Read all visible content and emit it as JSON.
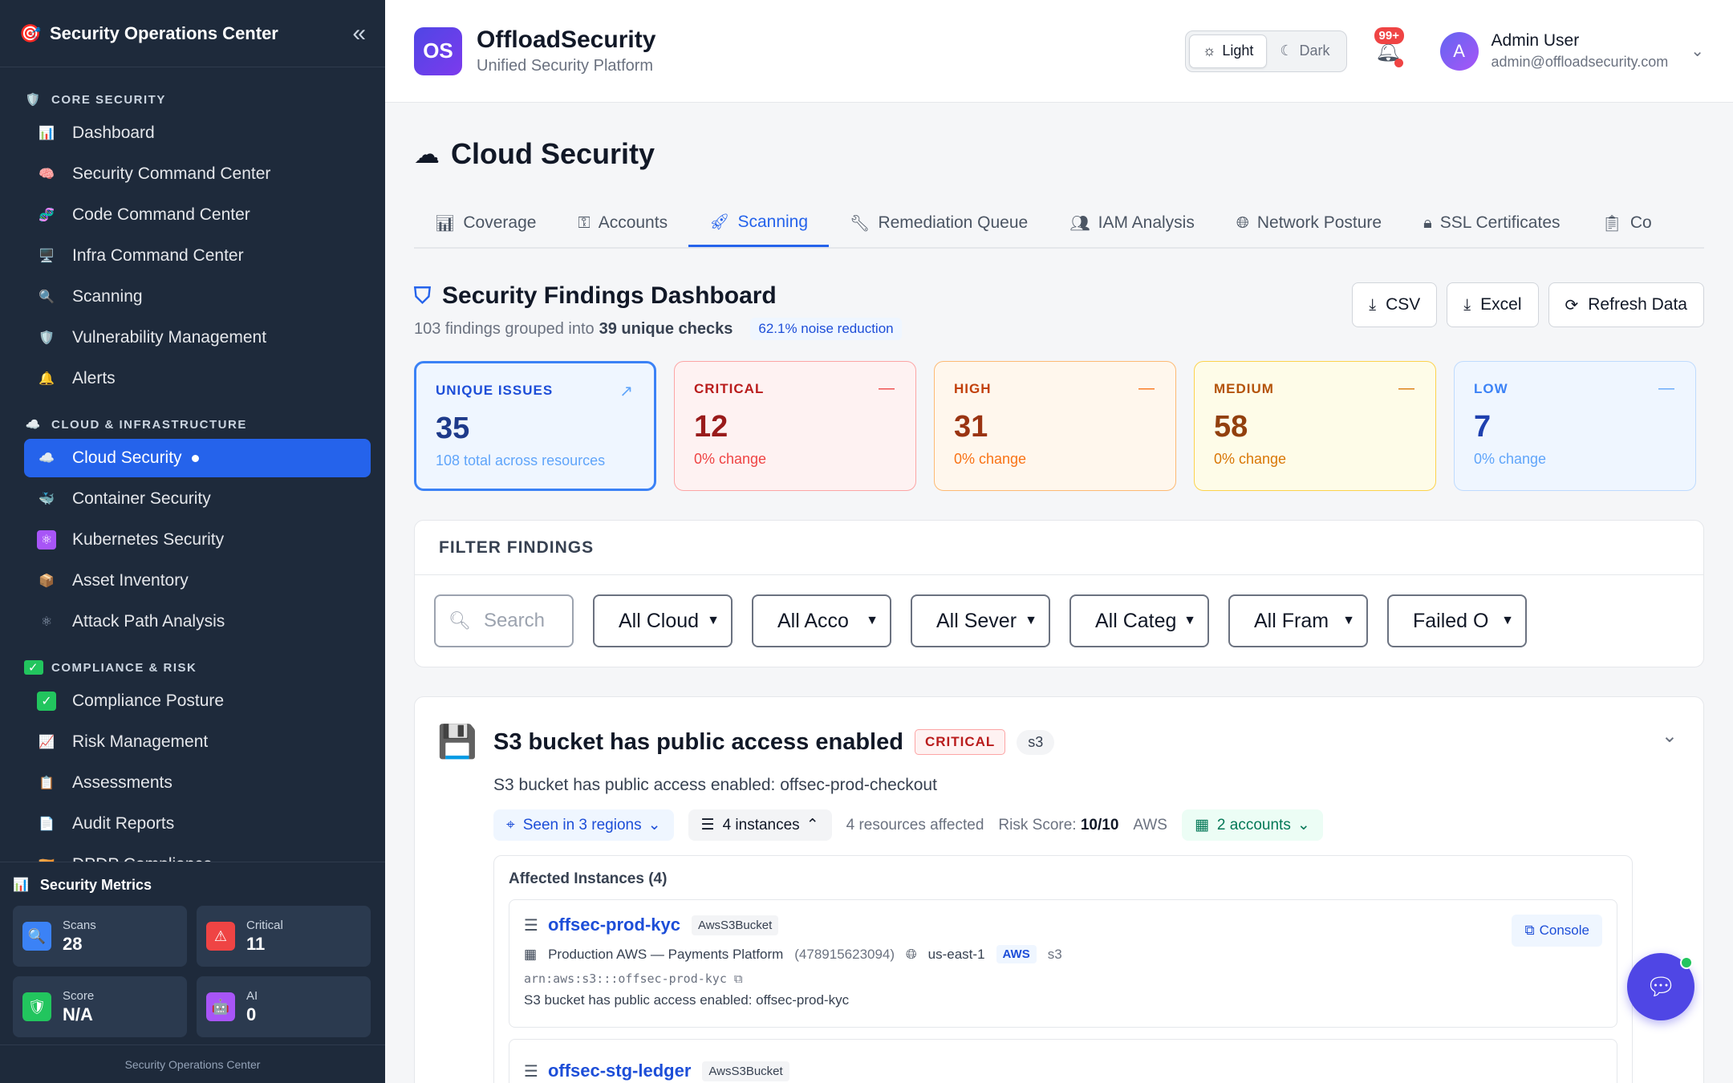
{
  "sidebar": {
    "title": "Security Operations Center",
    "sections": [
      {
        "label": "CORE SECURITY",
        "items": [
          {
            "label": "Dashboard",
            "icon": "bar-chart-icon"
          },
          {
            "label": "Security Command Center",
            "icon": "brain-icon"
          },
          {
            "label": "Code Command Center",
            "icon": "dna-icon"
          },
          {
            "label": "Infra Command Center",
            "icon": "monitor-icon"
          },
          {
            "label": "Scanning",
            "icon": "magnifier-icon"
          },
          {
            "label": "Vulnerability Management",
            "icon": "shield-icon"
          },
          {
            "label": "Alerts",
            "icon": "bell-icon"
          }
        ]
      },
      {
        "label": "CLOUD & INFRASTRUCTURE",
        "items": [
          {
            "label": "Cloud Security",
            "icon": "cloud-icon",
            "active": true
          },
          {
            "label": "Container Security",
            "icon": "whale-icon"
          },
          {
            "label": "Kubernetes Security",
            "icon": "atom-icon"
          },
          {
            "label": "Asset Inventory",
            "icon": "package-icon"
          },
          {
            "label": "Attack Path Analysis",
            "icon": "network-icon"
          }
        ]
      },
      {
        "label": "COMPLIANCE & RISK",
        "items": [
          {
            "label": "Compliance Posture",
            "icon": "check-box-icon"
          },
          {
            "label": "Risk Management",
            "icon": "line-chart-icon"
          },
          {
            "label": "Assessments",
            "icon": "clipboard-icon"
          },
          {
            "label": "Audit Reports",
            "icon": "document-icon"
          },
          {
            "label": "DPDP Compliance",
            "icon": "flag-icon"
          }
        ]
      }
    ],
    "metrics_title": "Security Metrics",
    "metrics": [
      {
        "label": "Scans",
        "value": "28",
        "icon": "magnifier-icon",
        "color": "#3b82f6"
      },
      {
        "label": "Critical",
        "value": "11",
        "icon": "warning-icon",
        "color": "#ef4444"
      },
      {
        "label": "Score",
        "value": "N/A",
        "icon": "shield-icon",
        "color": "#22c55e"
      },
      {
        "label": "AI",
        "value": "0",
        "icon": "robot-icon",
        "color": "#a855f7"
      }
    ],
    "footer": "Security Operations Center"
  },
  "header": {
    "logo": "OS",
    "brand": "OffloadSecurity",
    "subtitle": "Unified Security Platform",
    "theme_light": "Light",
    "theme_dark": "Dark",
    "notifications": "99+",
    "avatar": "A",
    "user_name": "Admin User",
    "user_email": "admin@offloadsecurity.com"
  },
  "page": {
    "title": "Cloud Security",
    "tabs": [
      {
        "label": "Coverage",
        "icon": "bar-chart-icon"
      },
      {
        "label": "Accounts",
        "icon": "key-icon"
      },
      {
        "label": "Scanning",
        "icon": "rocket-icon",
        "active": true
      },
      {
        "label": "Remediation Queue",
        "icon": "wrench-icon"
      },
      {
        "label": "IAM Analysis",
        "icon": "users-icon"
      },
      {
        "label": "Network Posture",
        "icon": "globe-icon"
      },
      {
        "label": "SSL Certificates",
        "icon": "lock-icon"
      },
      {
        "label": "Co",
        "icon": "clipboard-icon"
      }
    ]
  },
  "findings": {
    "title": "Security Findings Dashboard",
    "sub_prefix": "103 findings grouped into",
    "sub_unique": "39 unique checks",
    "noise": "62.1% noise reduction",
    "actions": {
      "csv": "CSV",
      "excel": "Excel",
      "refresh": "Refresh Data"
    },
    "cards": [
      {
        "label": "UNIQUE ISSUES",
        "value": "35",
        "sub": "108 total across resources"
      },
      {
        "label": "CRITICAL",
        "value": "12",
        "sub": "0% change"
      },
      {
        "label": "HIGH",
        "value": "31",
        "sub": "0% change"
      },
      {
        "label": "MEDIUM",
        "value": "58",
        "sub": "0% change"
      },
      {
        "label": "LOW",
        "value": "7",
        "sub": "0% change"
      }
    ]
  },
  "filters": {
    "title": "FILTER FINDINGS",
    "search_placeholder": "Search",
    "selects": [
      "All Cloud",
      "All Acco",
      "All Sever",
      "All Categ",
      "All Fram",
      "Failed O"
    ]
  },
  "finding": {
    "title": "S3 bucket has public access enabled",
    "severity": "CRITICAL",
    "service": "s3",
    "description": "S3 bucket has public access enabled: offsec-prod-checkout",
    "regions": "Seen in 3 regions",
    "instances": "4 instances",
    "resources": "4 resources affected",
    "risk_label": "Risk Score:",
    "risk_value": "10/10",
    "provider": "AWS",
    "accounts": "2 accounts",
    "affected_title": "Affected Instances (4)",
    "instance1": {
      "name": "offsec-prod-kyc",
      "type": "AwsS3Bucket",
      "account": "Production AWS — Payments Platform",
      "account_id": "(478915623094)",
      "region": "us-east-1",
      "provider": "AWS",
      "service": "s3",
      "arn": "arn:aws:s3:::offsec-prod-kyc",
      "desc": "S3 bucket has public access enabled: offsec-prod-kyc",
      "console": "Console"
    },
    "instance2": {
      "name": "offsec-stg-ledger",
      "type": "AwsS3Bucket"
    }
  }
}
